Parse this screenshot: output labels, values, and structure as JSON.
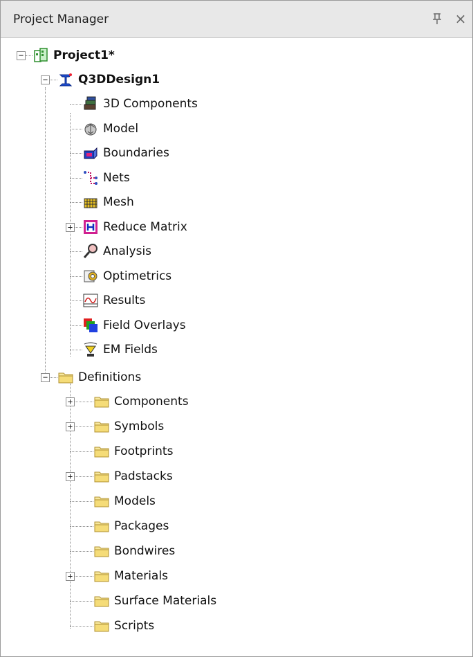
{
  "panel": {
    "title": "Project Manager",
    "pin_glyph": "个",
    "close_glyph": "×"
  },
  "tree": {
    "project": {
      "label": "Project1*",
      "icon": "project-icon",
      "expanded": true
    },
    "design": {
      "label": "Q3DDesign1",
      "icon": "q3d-design-icon",
      "expanded": true
    },
    "design_items": [
      {
        "label": "3D Components",
        "icon": "3d-components-icon",
        "expandable": false
      },
      {
        "label": "Model",
        "icon": "model-icon",
        "expandable": false
      },
      {
        "label": "Boundaries",
        "icon": "boundaries-icon",
        "expandable": false
      },
      {
        "label": "Nets",
        "icon": "nets-icon",
        "expandable": false
      },
      {
        "label": "Mesh",
        "icon": "mesh-icon",
        "expandable": false
      },
      {
        "label": "Reduce Matrix",
        "icon": "reduce-matrix-icon",
        "expandable": true
      },
      {
        "label": "Analysis",
        "icon": "analysis-icon",
        "expandable": false
      },
      {
        "label": "Optimetrics",
        "icon": "optimetrics-icon",
        "expandable": false
      },
      {
        "label": "Results",
        "icon": "results-icon",
        "expandable": false
      },
      {
        "label": "Field Overlays",
        "icon": "field-overlays-icon",
        "expandable": false
      },
      {
        "label": "EM Fields",
        "icon": "em-fields-icon",
        "expandable": false
      }
    ],
    "definitions": {
      "label": "Definitions",
      "icon": "folder-icon",
      "expanded": true
    },
    "definition_items": [
      {
        "label": "Components",
        "icon": "folder-icon",
        "expandable": true
      },
      {
        "label": "Symbols",
        "icon": "folder-icon",
        "expandable": true
      },
      {
        "label": "Footprints",
        "icon": "folder-icon",
        "expandable": false
      },
      {
        "label": "Padstacks",
        "icon": "folder-icon",
        "expandable": true
      },
      {
        "label": "Models",
        "icon": "folder-icon",
        "expandable": false
      },
      {
        "label": "Packages",
        "icon": "folder-icon",
        "expandable": false
      },
      {
        "label": "Bondwires",
        "icon": "folder-icon",
        "expandable": false
      },
      {
        "label": "Materials",
        "icon": "folder-icon",
        "expandable": true
      },
      {
        "label": "Surface Materials",
        "icon": "folder-icon",
        "expandable": false
      },
      {
        "label": "Scripts",
        "icon": "folder-icon",
        "expandable": false
      }
    ]
  },
  "colors": {
    "titlebar_bg": "#e8e8e8",
    "connector": "#8a8a8a",
    "folder_fill": "#f2dc7a",
    "project_green": "#3aa03a",
    "design_blue": "#1f4fd6"
  }
}
